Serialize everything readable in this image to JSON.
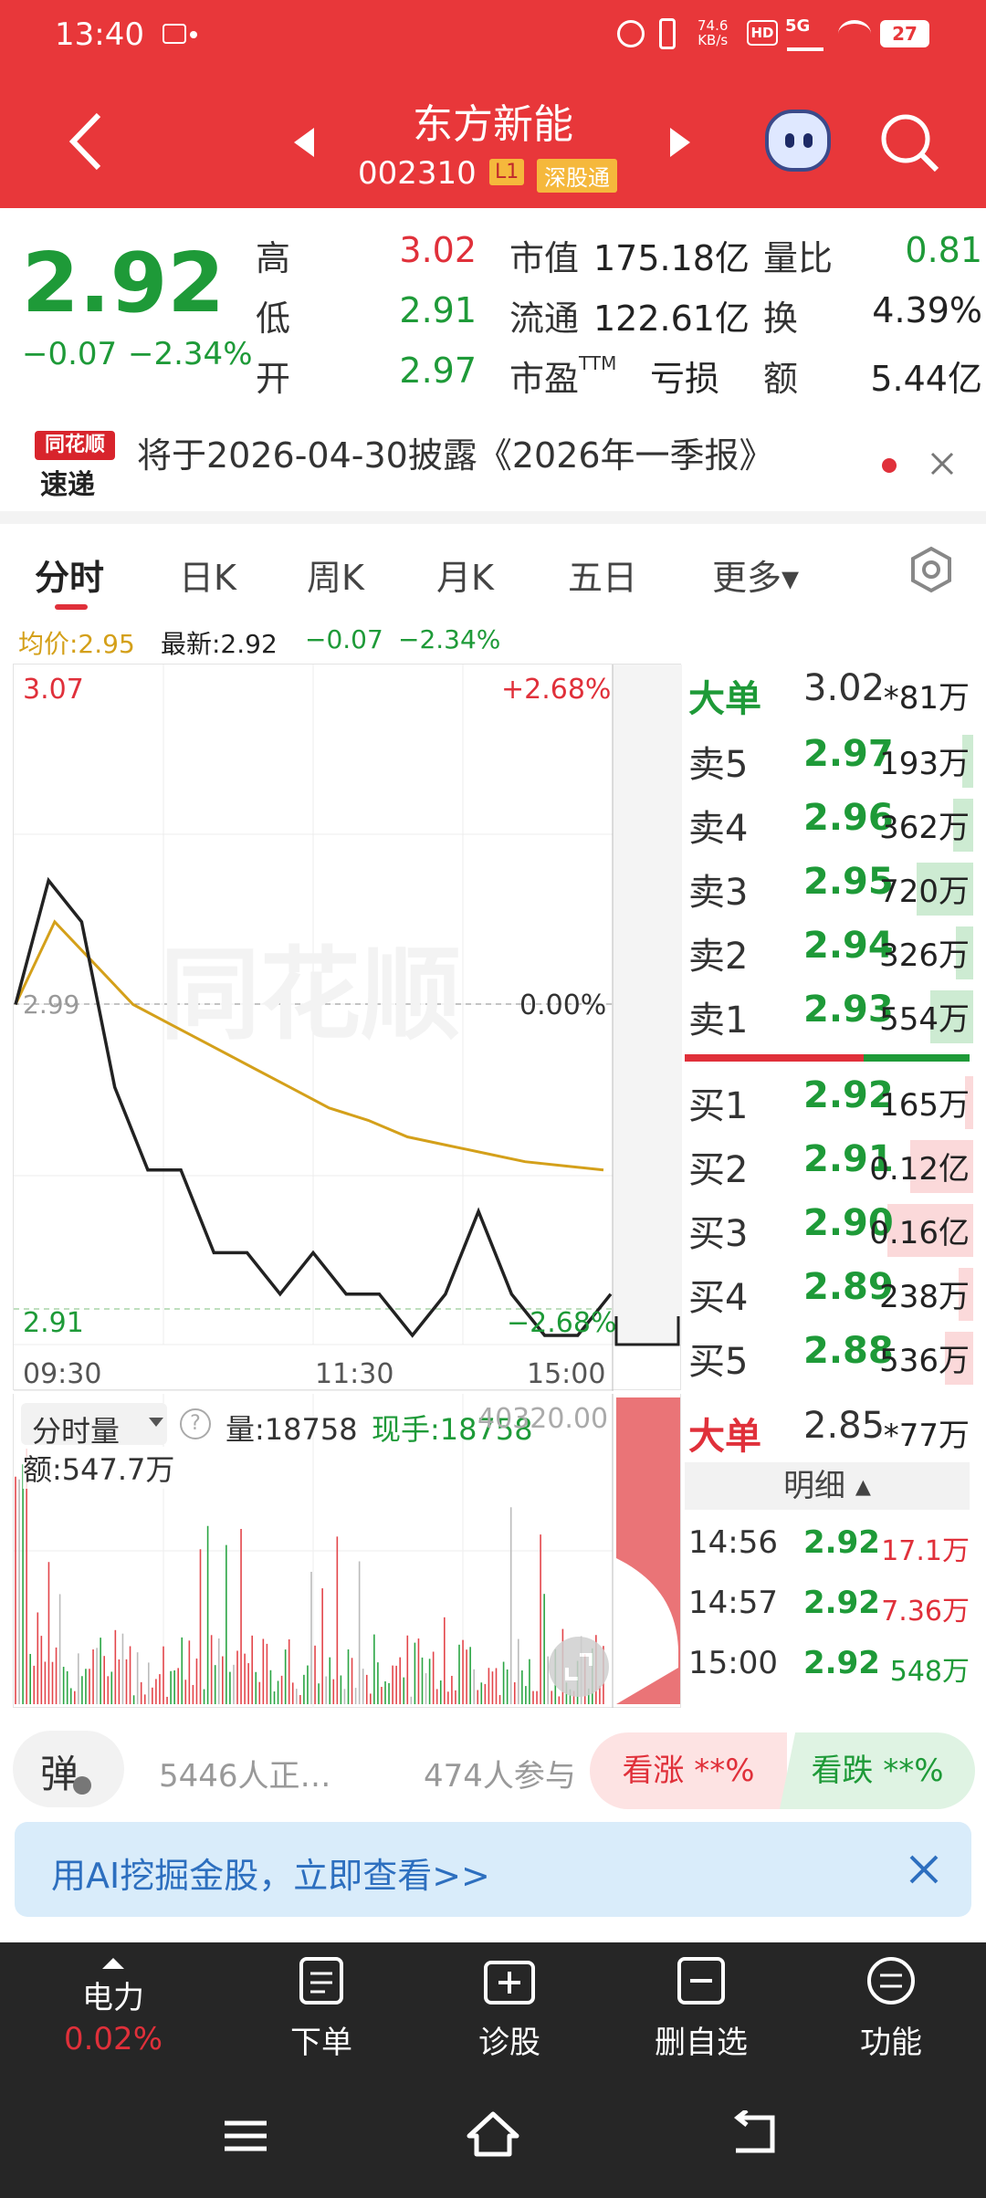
{
  "status": {
    "time": "13:40",
    "speed_num": "74.6",
    "speed_unit": "KB/s",
    "net": "5G",
    "battery": "27"
  },
  "header": {
    "title": "东方新能",
    "code": "002310",
    "level": "L1",
    "tag": "深股通"
  },
  "quote": {
    "price": "2.92",
    "change": "−0.07",
    "pct": "−2.34%",
    "high_l": "高",
    "high": "3.02",
    "low_l": "低",
    "low": "2.91",
    "open_l": "开",
    "open": "2.97",
    "mcap_l": "市值",
    "mcap": "175.18亿",
    "float_l": "流通",
    "float": "122.61亿",
    "pe_l": "市盈",
    "pe_sup": "TTM",
    "pe": "亏损",
    "vr_l": "量比",
    "vr": "0.81",
    "turn_l": "换",
    "turn": "4.39%",
    "amt_l": "额",
    "amt": "5.44亿"
  },
  "news": {
    "logo_top": "同花顺",
    "logo_bottom": "速递",
    "text": "将于2026-04-30披露《2026年一季报》"
  },
  "tabs": [
    "分时",
    "日K",
    "周K",
    "月K",
    "五日",
    "更多▾"
  ],
  "info": {
    "avg": "均价:2.95",
    "latest": "最新:2.92",
    "chg": "−0.07",
    "pct": "−2.34%"
  },
  "chart": {
    "top_price": "3.07",
    "top_pct": "+2.68%",
    "mid_price": "2.99",
    "mid_pct": "0.00%",
    "low_price": "2.91",
    "low_pct": "−2.68%",
    "t_start": "09:30",
    "t_mid": "11:30",
    "t_end": "15:00",
    "watermark": "同花顺",
    "vol_label": "分时量",
    "vol": "量:18758",
    "hand": "现手:18758",
    "vol_max": "40320.00",
    "amount": "额:547.7万"
  },
  "chart_data": {
    "type": "line",
    "x": [
      "09:30",
      "11:30",
      "15:00"
    ],
    "ylim": [
      2.91,
      3.07
    ],
    "series": [
      {
        "values": [
          2.99,
          3.02,
          3.01,
          2.97,
          2.95,
          2.95,
          2.93,
          2.93,
          2.92,
          2.93,
          2.92,
          2.92,
          2.91,
          2.92,
          2.94,
          2.92,
          2.91,
          2.91,
          2.92
        ]
      },
      {
        "values": [
          2.99,
          3.01,
          3.0,
          2.99,
          2.985,
          2.98,
          2.975,
          2.97,
          2.965,
          2.962,
          2.958,
          2.956,
          2.954,
          2.952,
          2.951,
          2.95
        ]
      }
    ]
  },
  "orderbook": {
    "big_sell": {
      "label": "大单",
      "price": "3.02",
      "vol": "*81万"
    },
    "sells": [
      {
        "label": "卖5",
        "price": "2.97",
        "vol": "193万",
        "bar": 0.04
      },
      {
        "label": "卖4",
        "price": "2.96",
        "vol": "362万",
        "bar": 0.07
      },
      {
        "label": "卖3",
        "price": "2.95",
        "vol": "720万",
        "bar": 0.2
      },
      {
        "label": "卖2",
        "price": "2.94",
        "vol": "326万",
        "bar": 0.06
      },
      {
        "label": "卖1",
        "price": "2.93",
        "vol": "554万",
        "bar": 0.15
      }
    ],
    "buys": [
      {
        "label": "买1",
        "price": "2.92",
        "vol": "165万",
        "bar": 0.03
      },
      {
        "label": "买2",
        "price": "2.91",
        "vol": "0.12亿",
        "bar": 0.22
      },
      {
        "label": "买3",
        "price": "2.90",
        "vol": "0.16亿",
        "bar": 0.3
      },
      {
        "label": "买4",
        "price": "2.89",
        "vol": "238万",
        "bar": 0.05
      },
      {
        "label": "买5",
        "price": "2.88",
        "vol": "536万",
        "bar": 0.1
      }
    ],
    "big_buy": {
      "label": "大单",
      "price": "2.85",
      "vol": "*77万"
    }
  },
  "detail": {
    "label": "明细 ▴",
    "rows": [
      {
        "t": "14:56",
        "p": "2.92",
        "v": "17.1万"
      },
      {
        "t": "14:57",
        "p": "2.92",
        "v": "7.36万"
      },
      {
        "t": "15:00",
        "p": "2.92",
        "v": "548万"
      }
    ]
  },
  "social": {
    "danmu": "弹",
    "viewers": "5446人正…",
    "participants": "474人参与",
    "up": "看涨 **%",
    "down": "看跌 **%"
  },
  "ai": {
    "text": "用AI挖掘金股，立即查看>>"
  },
  "bottom": {
    "sector": "电力",
    "sector_pct": "0.02%",
    "order": "下单",
    "diag": "诊股",
    "del": "删自选",
    "func": "功能"
  }
}
